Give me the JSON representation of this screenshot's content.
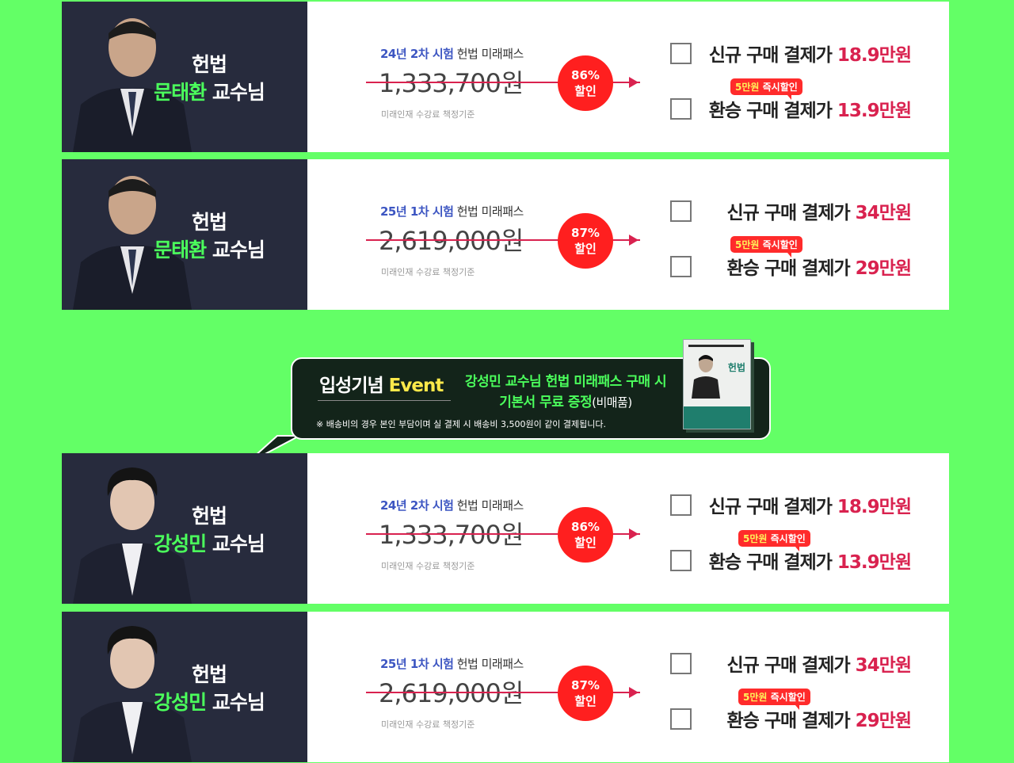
{
  "cards": [
    {
      "prof_subject": "헌법",
      "prof_name": "문태환",
      "prof_suffix": "교수님",
      "exam_highlight": "24년 2차 시험",
      "exam_rest": "헌법 미래패스",
      "original_price": "1,333,700원",
      "basis": "미래인재 수강료 책정기준",
      "discount_pct": "86%",
      "discount_word": "할인",
      "new_label": "신규 구매 결제가",
      "new_price": "18.9만원",
      "tag_main": "5만원",
      "tag_sub": "즉시할인",
      "return_label": "환승 구매 결제가",
      "return_price": "13.9만원"
    },
    {
      "prof_subject": "헌법",
      "prof_name": "문태환",
      "prof_suffix": "교수님",
      "exam_highlight": "25년 1차 시험",
      "exam_rest": "헌법 미래패스",
      "original_price": "2,619,000원",
      "basis": "미래인재 수강료 책정기준",
      "discount_pct": "87%",
      "discount_word": "할인",
      "new_label": "신규 구매 결제가",
      "new_price": "34만원",
      "tag_main": "5만원",
      "tag_sub": "즉시할인",
      "return_label": "환승 구매 결제가",
      "return_price": "29만원"
    },
    {
      "prof_subject": "헌법",
      "prof_name": "강성민",
      "prof_suffix": "교수님",
      "exam_highlight": "24년 2차 시험",
      "exam_rest": "헌법 미래패스",
      "original_price": "1,333,700원",
      "basis": "미래인재 수강료 책정기준",
      "discount_pct": "86%",
      "discount_word": "할인",
      "new_label": "신규 구매 결제가",
      "new_price": "18.9만원",
      "tag_main": "5만원",
      "tag_sub": "즉시할인",
      "return_label": "환승 구매 결제가",
      "return_price": "13.9만원"
    },
    {
      "prof_subject": "헌법",
      "prof_name": "강성민",
      "prof_suffix": "교수님",
      "exam_highlight": "25년 1차 시험",
      "exam_rest": "헌법 미래패스",
      "original_price": "2,619,000원",
      "basis": "미래인재 수강료 책정기준",
      "discount_pct": "87%",
      "discount_word": "할인",
      "new_label": "신규 구매 결제가",
      "new_price": "34만원",
      "tag_main": "5만원",
      "tag_sub": "즉시할인",
      "return_label": "환승 구매 결제가",
      "return_price": "29만원"
    }
  ],
  "event": {
    "title_main": "입성기념",
    "title_accent": "Event",
    "desc_line1": "강성민 교수님 헌법 미래패스 구매 시",
    "desc_line2": "기본서 무료 증정",
    "desc_note": "(비매품)",
    "shipping_note": "※ 배송비의 경우 본인 부담이며 실 결제 시 배송비 3,500원이 같이 결제됩니다.",
    "book_title": "헌법"
  },
  "colors": {
    "background": "#63ff66",
    "panel": "#272b3d",
    "accent_green": "#4bff5c",
    "price_red": "#d9224f",
    "badge_red": "#ff1f1f"
  }
}
